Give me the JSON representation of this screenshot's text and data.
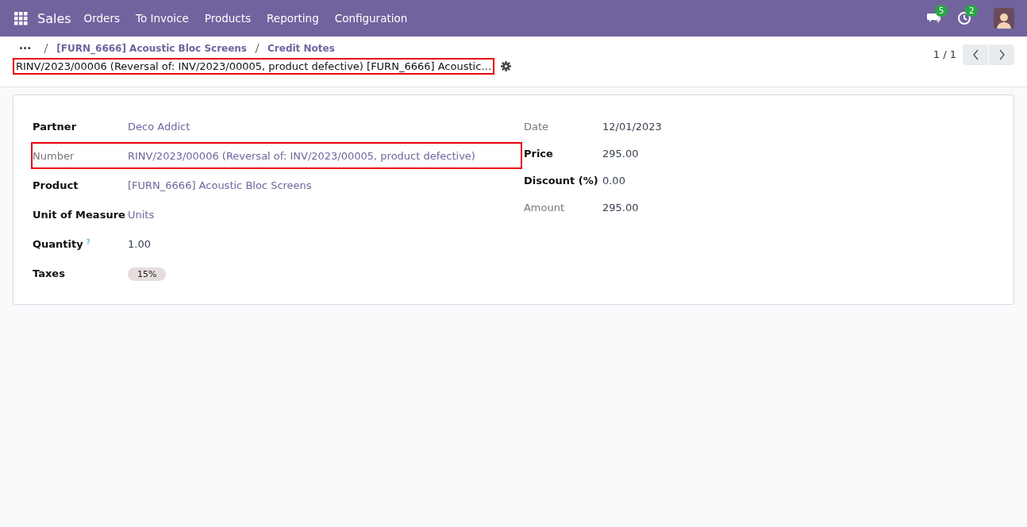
{
  "navbar": {
    "app": "Sales",
    "menu": [
      "Orders",
      "To Invoice",
      "Products",
      "Reporting",
      "Configuration"
    ],
    "messages_badge": "5",
    "activities_badge": "2"
  },
  "breadcrumb": {
    "ellipsis": "•••",
    "items": [
      "[FURN_6666] Acoustic Bloc Screens",
      "Credit Notes"
    ]
  },
  "record_title": {
    "text": "RINV/2023/00006 (Reversal of: INV/2023/00005, product defective) [FURN_6666] Acoustic…",
    "highlighted": true
  },
  "pager": {
    "value": "1 / 1"
  },
  "left_fields": [
    {
      "label": "Partner",
      "readonly": false,
      "kind": "link",
      "value": "Deco Addict",
      "highlighted": false
    },
    {
      "label": "Number",
      "readonly": true,
      "kind": "link",
      "value": "RINV/2023/00006 (Reversal of: INV/2023/00005, product defective)",
      "highlighted": true
    },
    {
      "label": "Product",
      "readonly": false,
      "kind": "link",
      "value": "[FURN_6666] Acoustic Bloc Screens",
      "highlighted": false
    },
    {
      "label": "Unit of Measure",
      "readonly": false,
      "kind": "link",
      "value": "Units",
      "highlighted": false
    },
    {
      "label": "Quantity",
      "help": "?",
      "readonly": false,
      "kind": "text",
      "value": "1.00",
      "highlighted": false
    },
    {
      "label": "Taxes",
      "readonly": false,
      "kind": "tag",
      "value": "15%",
      "highlighted": false
    }
  ],
  "right_fields": [
    {
      "label": "Date",
      "readonly": true,
      "kind": "text",
      "value": "12/01/2023",
      "highlighted": false
    },
    {
      "label": "Price",
      "readonly": false,
      "kind": "text",
      "value": "295.00",
      "highlighted": false
    },
    {
      "label": "Discount (%)",
      "readonly": false,
      "kind": "text",
      "value": "0.00",
      "highlighted": false
    },
    {
      "label": "Amount",
      "readonly": true,
      "kind": "text",
      "value": "295.00",
      "highlighted": false
    }
  ]
}
